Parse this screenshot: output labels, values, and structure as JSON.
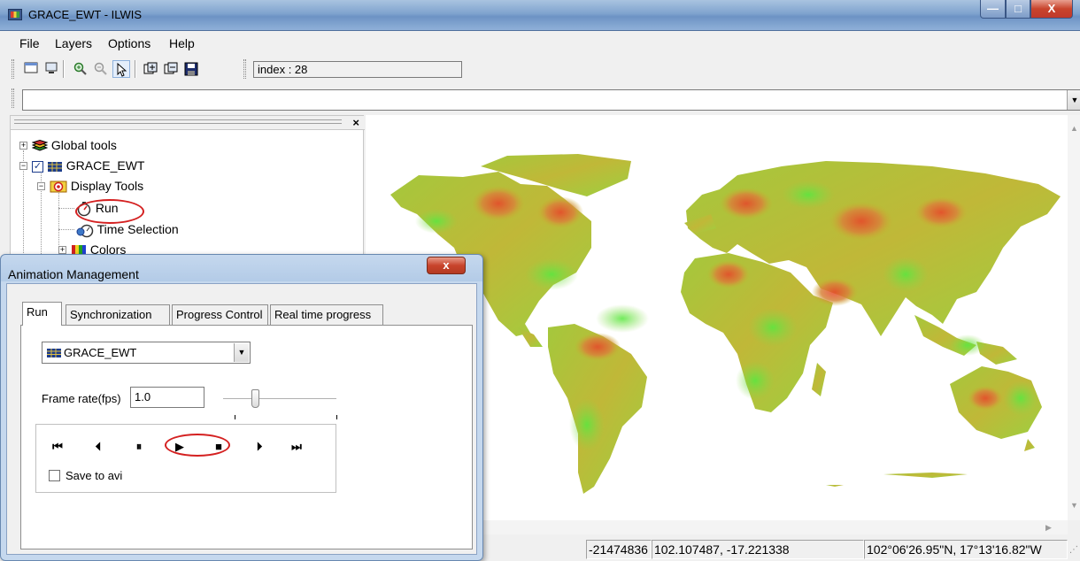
{
  "window": {
    "title": "GRACE_EWT - ILWIS"
  },
  "menubar": {
    "items": [
      "File",
      "Layers",
      "Options",
      "Help"
    ]
  },
  "toolbar": {
    "index_text": "index : 28"
  },
  "tree": {
    "nodes": [
      {
        "label": "Global tools"
      },
      {
        "label": "GRACE_EWT"
      },
      {
        "label": "Display Tools"
      },
      {
        "label": "Run"
      },
      {
        "label": "Time Selection"
      },
      {
        "label": "Colors"
      }
    ]
  },
  "statusbar": {
    "raw_value": "-21474836",
    "coordinates": "102.107487, -17.221338",
    "latlon": "102°06'26.95\"N, 17°13'16.82\"W"
  },
  "dialog": {
    "title": "Animation Management",
    "close_label": "x",
    "tabs": [
      {
        "label": "Run",
        "active": true
      },
      {
        "label": "Synchronization",
        "active": false
      },
      {
        "label": "Progress Control",
        "active": false
      },
      {
        "label": "Real time progress",
        "active": false
      }
    ],
    "map_selected": "GRACE_EWT",
    "fps_label": "Frame rate(fps)",
    "fps_value": "1.0",
    "player_buttons": [
      {
        "name": "first-frame-button",
        "glyph": "⏮"
      },
      {
        "name": "step-back-button",
        "glyph": "⏴"
      },
      {
        "name": "pause-button",
        "glyph": "⏸"
      },
      {
        "name": "play-button",
        "glyph": "▶"
      },
      {
        "name": "stop-button",
        "glyph": "■"
      },
      {
        "name": "step-forward-button",
        "glyph": "⏵"
      },
      {
        "name": "last-frame-button",
        "glyph": "⏭"
      }
    ],
    "save_avi_label": "Save to avi",
    "save_avi_checked": false
  },
  "colors": {
    "map_low": "#e8442a",
    "map_mid": "#c8b030",
    "map_high": "#58e840",
    "highlight_ellipse": "#d42020"
  }
}
